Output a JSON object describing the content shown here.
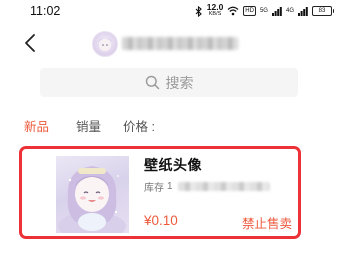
{
  "status_bar": {
    "time": "11:02",
    "net_speed": "12.0",
    "net_speed_unit": "KB/S",
    "hd_label": "HD",
    "signal_1": "5G",
    "signal_2": "4G",
    "battery": "83"
  },
  "header": {
    "back_icon": "chevron-left-icon"
  },
  "search": {
    "placeholder": "搜索",
    "icon": "search-icon"
  },
  "tabs": [
    {
      "label": "新品",
      "active": true
    },
    {
      "label": "销量",
      "active": false
    },
    {
      "label": "价格 :",
      "active": false
    }
  ],
  "product": {
    "title": "壁纸头像",
    "stock_label": "库存",
    "stock_value": "1",
    "price": "¥0.10",
    "action_label": "禁止售卖"
  },
  "colors": {
    "accent": "#ee5a3c",
    "card_border": "#ec3237",
    "search_bg": "#f5f5f5"
  }
}
